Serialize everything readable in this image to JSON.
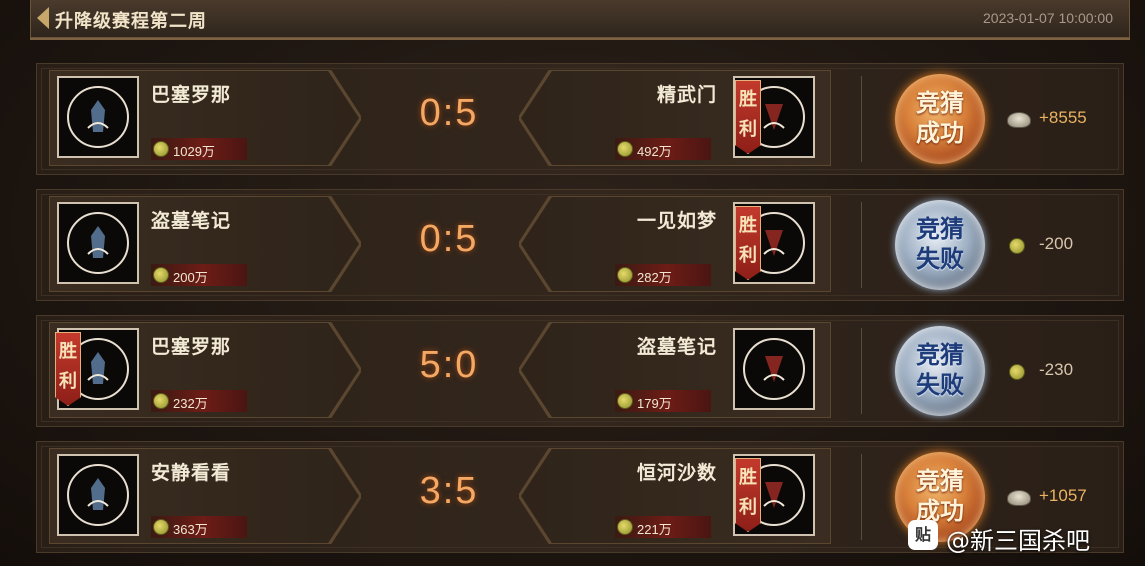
{
  "header": {
    "title": "升降级赛程第二周",
    "datetime": "2023-01-07 10:00:00"
  },
  "matches": [
    {
      "left_team": "巴塞罗那",
      "left_money": "1029万",
      "left_win": false,
      "left_win_label": "",
      "right_team": "精武门",
      "right_money": "492万",
      "right_win": true,
      "right_win_label": "胜\n利",
      "score": "0:5",
      "result_line1": "竞猜",
      "result_line2": "成功",
      "result": "success",
      "reward_icon": "silver-ingot-icon",
      "reward": "+8555"
    },
    {
      "left_team": "盗墓笔记",
      "left_money": "200万",
      "left_win": false,
      "left_win_label": "",
      "right_team": "一见如梦",
      "right_money": "282万",
      "right_win": true,
      "right_win_label": "胜\n利",
      "score": "0:5",
      "result_line1": "竞猜",
      "result_line2": "失败",
      "result": "fail",
      "reward_icon": "gold-coin-icon",
      "reward": "-200"
    },
    {
      "left_team": "巴塞罗那",
      "left_money": "232万",
      "left_win": true,
      "left_win_label": "胜\n利",
      "right_team": "盗墓笔记",
      "right_money": "179万",
      "right_win": false,
      "right_win_label": "",
      "score": "5:0",
      "result_line1": "竞猜",
      "result_line2": "失败",
      "result": "fail",
      "reward_icon": "gold-coin-icon",
      "reward": "-230"
    },
    {
      "left_team": "安静看看",
      "left_money": "363万",
      "left_win": false,
      "left_win_label": "",
      "right_team": "恒河沙数",
      "right_money": "221万",
      "right_win": true,
      "right_win_label": "胜\n利",
      "score": "3:5",
      "result_line1": "竞猜",
      "result_line2": "成功",
      "result": "success",
      "reward_icon": "silver-ingot-icon",
      "reward": "+1057"
    }
  ],
  "win_label_top": "胜",
  "win_label_bottom": "利",
  "watermark": {
    "badge": "贴",
    "text": "@新三国杀吧"
  }
}
